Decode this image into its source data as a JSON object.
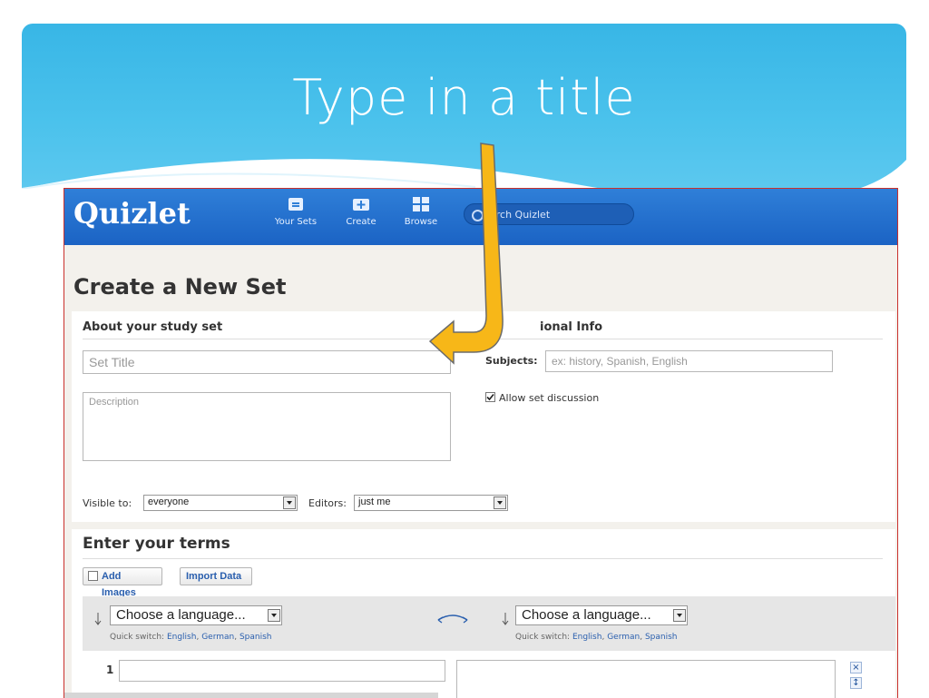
{
  "slide": {
    "title": "Type in a title",
    "accent_color": "#38b6e6",
    "arrow_color": "#f7b718"
  },
  "quizlet": {
    "logo": "Quizlet",
    "nav": [
      {
        "label": "Your Sets",
        "icon": "folder-icon"
      },
      {
        "label": "Create",
        "icon": "create-icon"
      },
      {
        "label": "Browse",
        "icon": "grid-icon"
      }
    ],
    "search_placeholder": "Search Quizlet",
    "search_visible_text": "arch Quizlet"
  },
  "page": {
    "title": "Create a New Set"
  },
  "about": {
    "heading": "About your study set",
    "title_placeholder": "Set Title",
    "description_placeholder": "Description",
    "visible_label": "Visible to:",
    "visible_value": "everyone",
    "editors_label": "Editors:",
    "editors_value": "just me"
  },
  "optional": {
    "heading_visible": "ional Info",
    "subjects_label": "Subjects:",
    "subjects_placeholder": "ex: history, Spanish, English",
    "allow_discussion_label": "Allow set discussion",
    "allow_discussion_checked": true
  },
  "terms": {
    "heading": "Enter your terms",
    "add_images_label": "Add Images",
    "import_label": "Import Data",
    "language_left": "Choose a language...",
    "language_right": "Choose a language...",
    "quick_switch_label": "Quick switch:",
    "quick_switch_options": [
      "English",
      "German",
      "Spanish"
    ],
    "row_number": "1"
  }
}
